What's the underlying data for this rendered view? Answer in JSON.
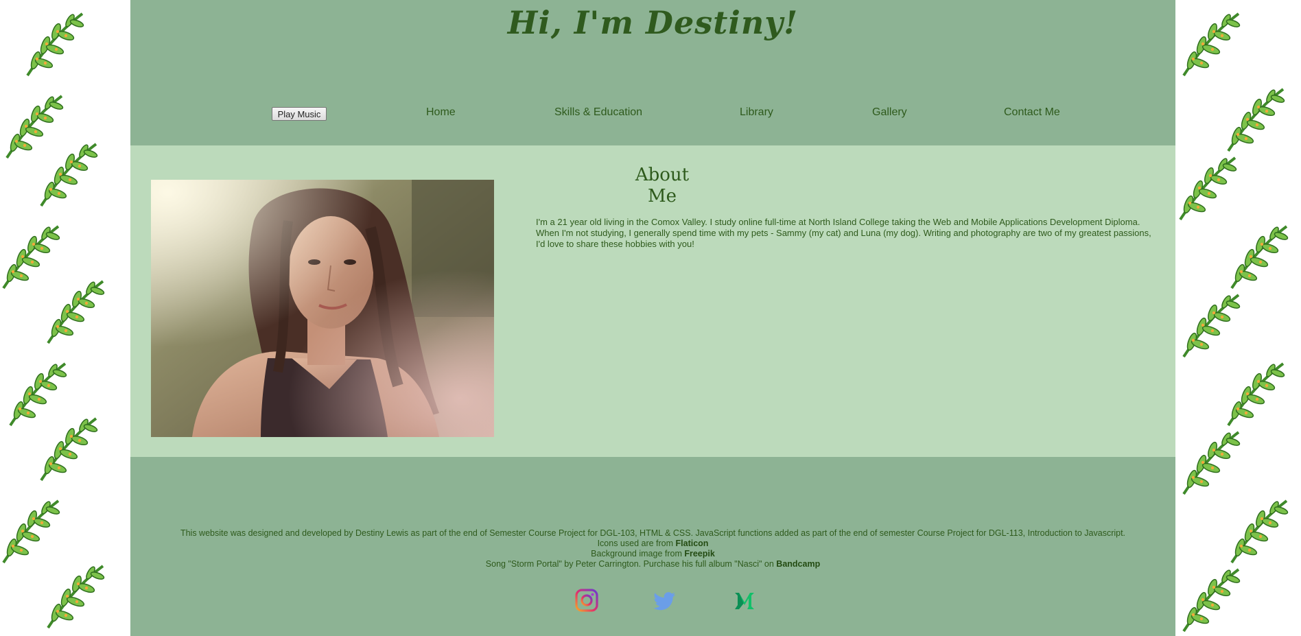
{
  "header": {
    "title": "Hi, I'm Destiny!"
  },
  "nav": {
    "play_button": "Play Music",
    "links": [
      "Home",
      "Skills & Education",
      "Library",
      "Gallery",
      "Contact Me"
    ]
  },
  "about": {
    "title_line1": "About",
    "title_line2": "Me",
    "text": "I'm a 21 year old living in the Comox Valley. I study online full-time at North Island College taking the Web and Mobile Applications Development Diploma. When I'm not studying, I generally spend time with my pets - Sammy (my cat) and Luna (my dog). Writing and photography are two of my greatest passions, I'd love to share these hobbies with you!"
  },
  "footer": {
    "line1": "This website was designed and developed by Destiny Lewis as part of the end of Semester Course Project for DGL-103, HTML & CSS. JavaScript functions added as part of the end of semester Course Project for DGL-113, Introduction to Javascript.",
    "icons_prefix": "Icons used are from",
    "icons_link": "Flaticon",
    "bg_prefix": "Background image from",
    "bg_link": "Freepik",
    "song_prefix": "Song \"Storm Portal\" by Peter Carrington. Purchase his full album \"Nasci\" on",
    "song_link": "Bandcamp"
  },
  "socials": [
    "instagram-icon",
    "twitter-icon",
    "medium-icon"
  ],
  "colors": {
    "header_bg": "#8db394",
    "main_bg": "#bcdabb",
    "text": "#2e5a1c"
  }
}
